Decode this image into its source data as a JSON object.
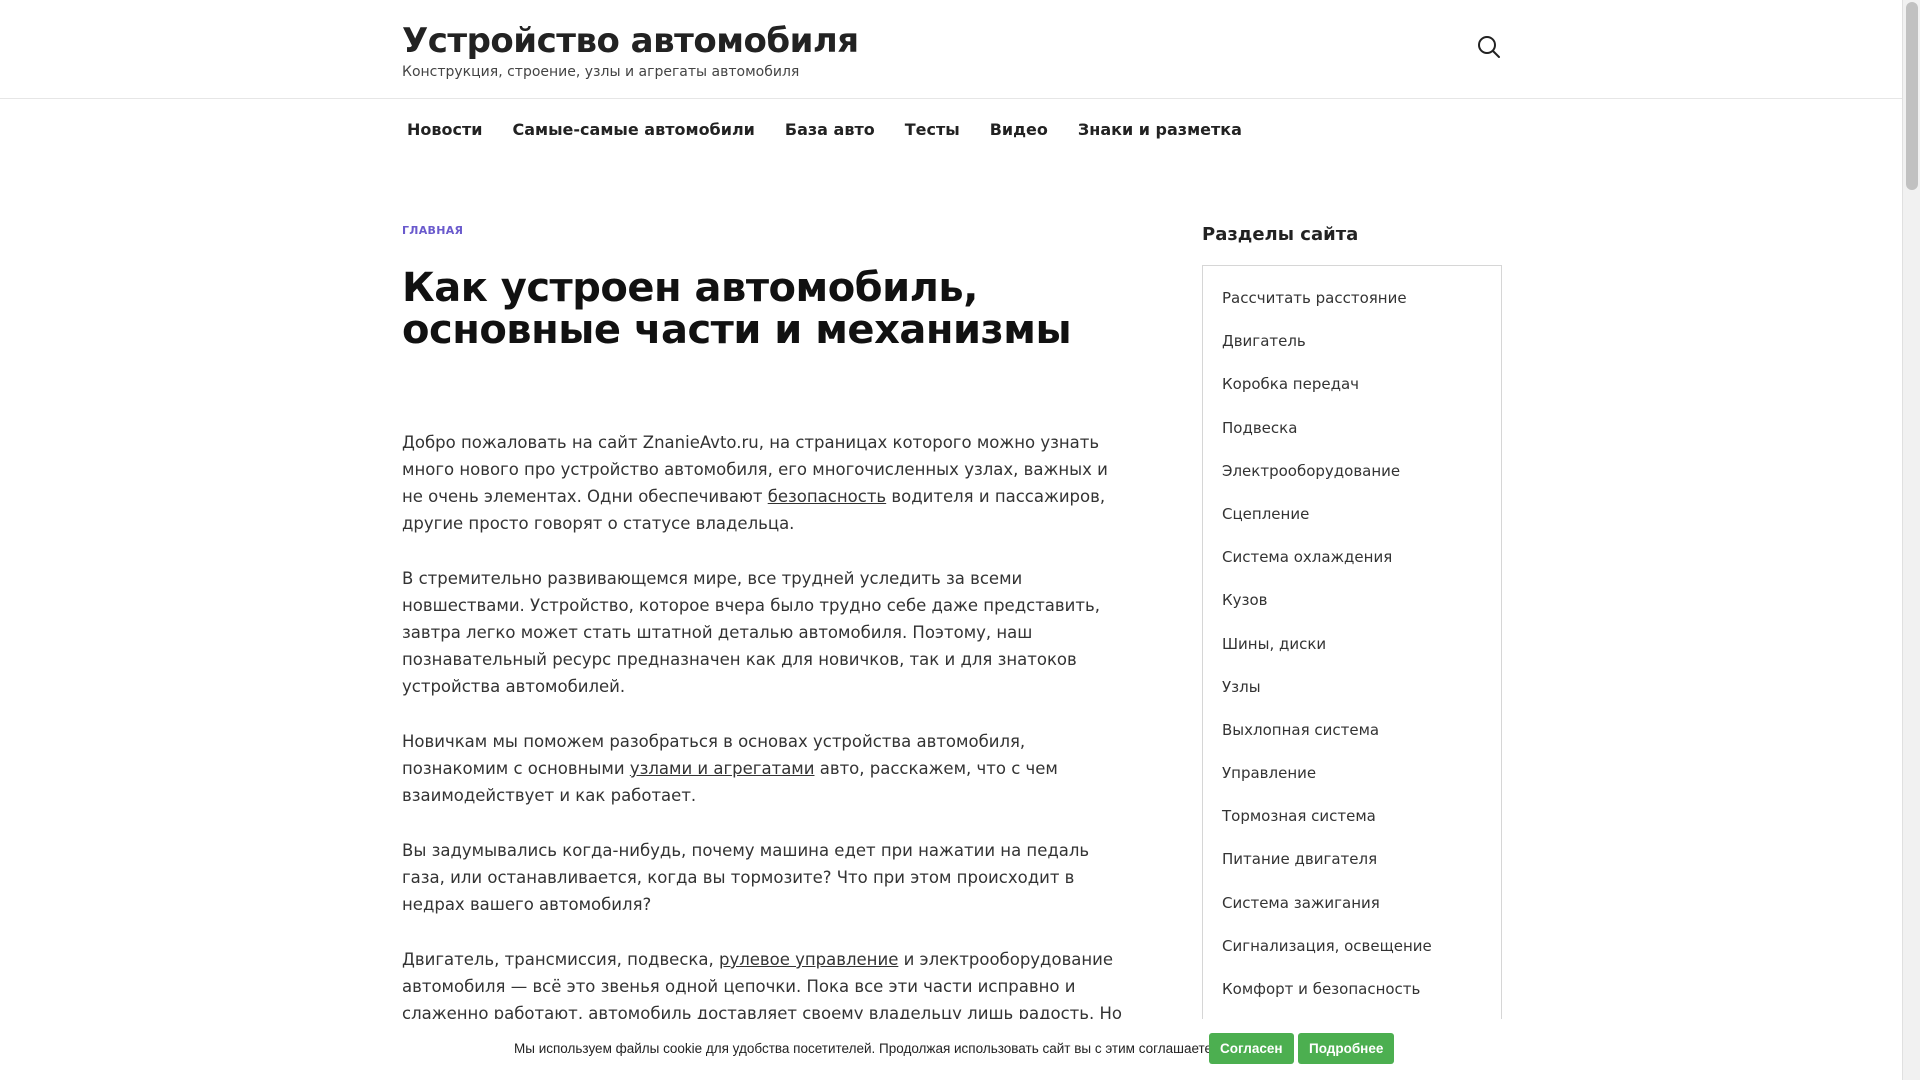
{
  "header": {
    "site_title": "Устройство автомобиля",
    "site_subtitle": "Конструкция, строение, узлы и агрегаты автомобиля",
    "search_icon": "search-icon"
  },
  "nav": {
    "items": [
      {
        "label": "Новости"
      },
      {
        "label": "Самые-самые автомобили"
      },
      {
        "label": "База авто"
      },
      {
        "label": "Тесты"
      },
      {
        "label": "Видео"
      },
      {
        "label": "Знаки и разметка"
      }
    ]
  },
  "main": {
    "breadcrumb": "ГЛАВНАЯ",
    "title": "Как устроен автомобиль, основные части и механизмы",
    "p1": {
      "before": "Добро пожаловать на сайт ZnanieAvto.ru, на страницах которого можно узнать много нового про устройство автомобиля, его многочисленных узлах, важных и не очень элементах. Одни обеспечивают ",
      "link": "безопасность",
      "after": " водителя и пассажиров, другие просто говорят о статусе владельца."
    },
    "p2": "В стремительно развивающемся мире, все трудней уследить за всеми новшествами. Устройство, которое вчера было трудно себе даже представить, завтра легко может стать штатной деталью автомобиля. Поэтому, наш познавательный ресурс предназначен как для новичков, так и для знатоков устройства автомобилей.",
    "p3": {
      "before": "Новичкам мы поможем разобраться в основах устройства автомобиля, познакомим с основными ",
      "link": "узлами и агрегатами",
      "after": " авто, расскажем, что с чем взаимодействует и как работает."
    },
    "p4": "Вы задумывались когда-нибудь, почему машина едет при нажатии на педаль газа, или останавливается, когда вы тормозите? Что при этом происходит в недрах вашего автомобиля?",
    "p5": {
      "before": "Двигатель, трансмиссия, подвеска, ",
      "link": "рулевое управление",
      "after": " и электрооборудование автомобиля — всё это звенья одной цепочки. Пока все эти части исправно и слаженно работают, автомобиль доставляет своему владельцу лишь радость. Но стоит отказать хоть одному из них, и машина начинает в лучшем случае – «барахлить», в худшем же —"
    }
  },
  "sidebar": {
    "title": "Разделы сайта",
    "items": [
      {
        "label": "Рассчитать расстояние"
      },
      {
        "label": "Двигатель"
      },
      {
        "label": "Коробка передач"
      },
      {
        "label": "Подвеска"
      },
      {
        "label": "Электрооборудование"
      },
      {
        "label": "Сцепление"
      },
      {
        "label": "Система охлаждения"
      },
      {
        "label": "Кузов"
      },
      {
        "label": "Шины, диски"
      },
      {
        "label": "Узлы"
      },
      {
        "label": "Выхлопная система"
      },
      {
        "label": "Управление"
      },
      {
        "label": "Тормозная система"
      },
      {
        "label": "Питание двигателя"
      },
      {
        "label": "Система зажигания"
      },
      {
        "label": "Сигнализация, освещение"
      },
      {
        "label": "Комфорт и безопасность"
      }
    ]
  },
  "cookie": {
    "text": "Мы используем файлы cookie для удобства посетителей. Продолжая использовать сайт вы с этим соглашаетесь",
    "accept_label": "Согласен",
    "more_label": "Подробнее",
    "button_color": "#4caf50"
  }
}
